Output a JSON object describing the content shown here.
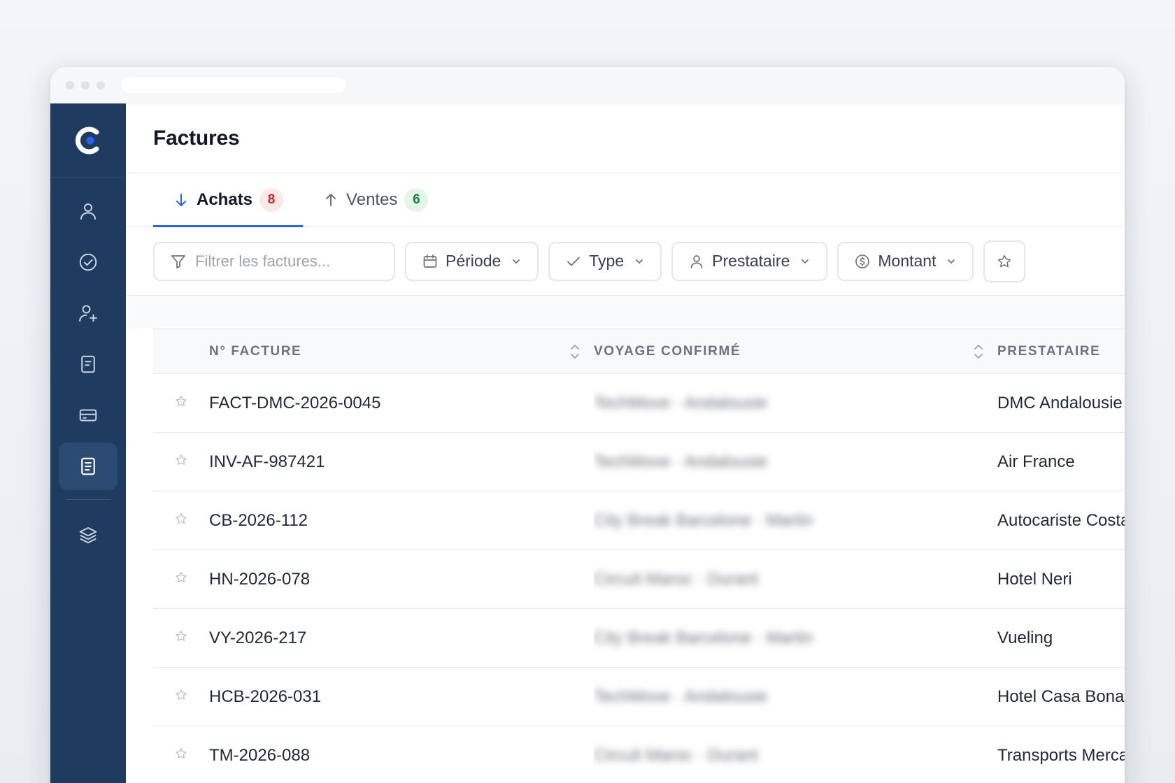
{
  "page": {
    "title": "Factures"
  },
  "tabs": [
    {
      "label": "Achats",
      "count": "8",
      "direction": "down",
      "active": true
    },
    {
      "label": "Ventes",
      "count": "6",
      "direction": "up",
      "active": false
    }
  ],
  "filters": {
    "search_placeholder": "Filtrer les factures...",
    "periode_label": "Période",
    "type_label": "Type",
    "prestataire_label": "Prestataire",
    "montant_label": "Montant"
  },
  "table": {
    "columns": [
      "N° Facture",
      "Voyage confirmé",
      "Prestataire"
    ],
    "rows": [
      {
        "invoice": "FACT-DMC-2026-0045",
        "trip": "TechMove · Andalousie",
        "provider": "DMC Andalousie"
      },
      {
        "invoice": "INV-AF-987421",
        "trip": "TechMove · Andalousie",
        "provider": "Air France"
      },
      {
        "invoice": "CB-2026-112",
        "trip": "City Break Barcelone · Martin",
        "provider": "Autocariste Costa"
      },
      {
        "invoice": "HN-2026-078",
        "trip": "Circuit Maroc · Durant",
        "provider": "Hotel Neri"
      },
      {
        "invoice": "VY-2026-217",
        "trip": "City Break Barcelone · Martin",
        "provider": "Vueling"
      },
      {
        "invoice": "HCB-2026-031",
        "trip": "TechMove · Andalousie",
        "provider": "Hotel Casa Bonay"
      },
      {
        "invoice": "TM-2026-088",
        "trip": "Circuit Maroc · Durant",
        "provider": "Transports Mercader"
      }
    ]
  },
  "colors": {
    "sidebar": "#1f3b5f",
    "sidebar_active": "#2c4b73",
    "accent": "#2563eb",
    "badge_red": "#c62828",
    "badge_green": "#15803d"
  },
  "icons": {
    "sidebar": [
      "user-icon",
      "check-circle-icon",
      "user-plus-icon",
      "document-icon",
      "credit-card-icon",
      "invoice-icon",
      "layers-icon"
    ]
  }
}
